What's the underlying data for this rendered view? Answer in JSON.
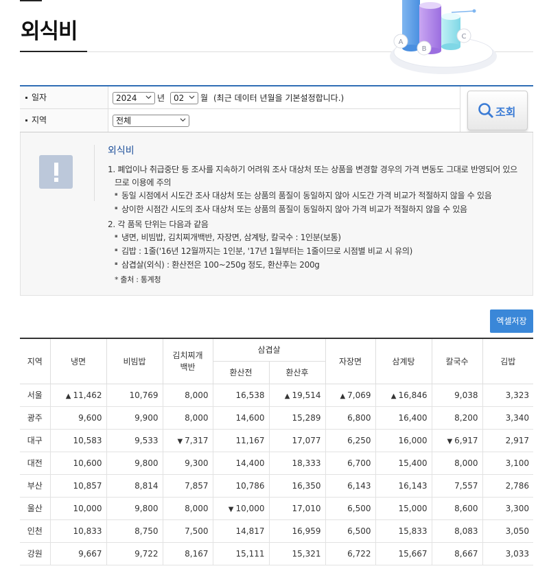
{
  "page": {
    "title": "외식비"
  },
  "hero": {
    "cylinder_labels": [
      "A",
      "B",
      "C"
    ]
  },
  "search": {
    "date_label": "일자",
    "year_value": "2024",
    "year_unit": "년",
    "month_value": "02",
    "month_unit": "월",
    "date_hint": "(최근 데이터 년월을 기본설정합니다.)",
    "region_label": "지역",
    "region_value": "전체",
    "query_button": "조회"
  },
  "notice": {
    "title": "외식비",
    "lines": [
      "1. 폐업이나 취급중단 등 조사를 지속하기 어려워 조사 대상처 또는 상품을 변경할 경우의 가격 변동도 그대로 반영되어 있으",
      "므로 이용에 주의",
      "동일 시점에서 시도간 조사 대상처 또는 상품의 품질이 동일하지 않아 시도간 가격 비교가 적절하지 않을 수 있음",
      "상이한 시점간 시도의 조사 대상처 또는 상품의 품질이 동일하지 않아 가격 비교가 적절하지 않을 수 있음",
      "2. 각 품목 단위는 다음과 같음",
      "냉면, 비빔밥, 김치찌개백반, 자장면, 삼계탕, 칼국수 : 1인분(보통)",
      "김밥 : 1줄('16년 12월까지는 1인분, '17년 1월부터는 1줄이므로 시점별 비교 시 유의)",
      "삼겹살(외식) : 환산전은 100~250g 정도, 환산후는 200g",
      "* 출처 : 통계청"
    ]
  },
  "excel_button": "엑셀저장",
  "table": {
    "headers": {
      "region": "지역",
      "naengmyeon": "냉면",
      "bibimbap": "비빔밥",
      "kimchi_line1": "김치찌개",
      "kimchi_line2": "백반",
      "samgyeopsal": "삼겹살",
      "before": "환산전",
      "after": "환산후",
      "jajangmyeon": "자장면",
      "samgyetang": "삼계탕",
      "kalguksu": "칼국수",
      "gimbap": "김밥"
    },
    "rows": [
      {
        "region": "서울",
        "cells": [
          {
            "v": "11,462",
            "t": "up"
          },
          {
            "v": "10,769",
            "t": ""
          },
          {
            "v": "8,000",
            "t": ""
          },
          {
            "v": "16,538",
            "t": ""
          },
          {
            "v": "19,514",
            "t": "up"
          },
          {
            "v": "7,069",
            "t": "up"
          },
          {
            "v": "16,846",
            "t": "up"
          },
          {
            "v": "9,038",
            "t": ""
          },
          {
            "v": "3,323",
            "t": ""
          }
        ]
      },
      {
        "region": "광주",
        "cells": [
          {
            "v": "9,600",
            "t": ""
          },
          {
            "v": "9,900",
            "t": ""
          },
          {
            "v": "8,000",
            "t": ""
          },
          {
            "v": "14,600",
            "t": ""
          },
          {
            "v": "15,289",
            "t": ""
          },
          {
            "v": "6,800",
            "t": ""
          },
          {
            "v": "16,400",
            "t": ""
          },
          {
            "v": "8,200",
            "t": ""
          },
          {
            "v": "3,340",
            "t": ""
          }
        ]
      },
      {
        "region": "대구",
        "cells": [
          {
            "v": "10,583",
            "t": ""
          },
          {
            "v": "9,533",
            "t": ""
          },
          {
            "v": "7,317",
            "t": "down"
          },
          {
            "v": "11,167",
            "t": ""
          },
          {
            "v": "17,077",
            "t": ""
          },
          {
            "v": "6,250",
            "t": ""
          },
          {
            "v": "16,000",
            "t": ""
          },
          {
            "v": "6,917",
            "t": "down"
          },
          {
            "v": "2,917",
            "t": ""
          }
        ]
      },
      {
        "region": "대전",
        "cells": [
          {
            "v": "10,600",
            "t": ""
          },
          {
            "v": "9,800",
            "t": ""
          },
          {
            "v": "9,300",
            "t": ""
          },
          {
            "v": "14,400",
            "t": ""
          },
          {
            "v": "18,333",
            "t": ""
          },
          {
            "v": "6,700",
            "t": ""
          },
          {
            "v": "15,400",
            "t": ""
          },
          {
            "v": "8,000",
            "t": ""
          },
          {
            "v": "3,100",
            "t": ""
          }
        ]
      },
      {
        "region": "부산",
        "cells": [
          {
            "v": "10,857",
            "t": ""
          },
          {
            "v": "8,814",
            "t": ""
          },
          {
            "v": "7,857",
            "t": ""
          },
          {
            "v": "10,786",
            "t": ""
          },
          {
            "v": "16,350",
            "t": ""
          },
          {
            "v": "6,143",
            "t": ""
          },
          {
            "v": "16,143",
            "t": ""
          },
          {
            "v": "7,557",
            "t": ""
          },
          {
            "v": "2,786",
            "t": ""
          }
        ]
      },
      {
        "region": "울산",
        "cells": [
          {
            "v": "10,000",
            "t": ""
          },
          {
            "v": "9,800",
            "t": ""
          },
          {
            "v": "8,000",
            "t": ""
          },
          {
            "v": "10,000",
            "t": "down"
          },
          {
            "v": "17,010",
            "t": ""
          },
          {
            "v": "6,500",
            "t": ""
          },
          {
            "v": "15,000",
            "t": ""
          },
          {
            "v": "8,600",
            "t": ""
          },
          {
            "v": "3,300",
            "t": ""
          }
        ]
      },
      {
        "region": "인천",
        "cells": [
          {
            "v": "10,833",
            "t": ""
          },
          {
            "v": "8,750",
            "t": ""
          },
          {
            "v": "7,500",
            "t": ""
          },
          {
            "v": "14,817",
            "t": ""
          },
          {
            "v": "16,959",
            "t": ""
          },
          {
            "v": "6,500",
            "t": ""
          },
          {
            "v": "15,833",
            "t": ""
          },
          {
            "v": "8,083",
            "t": ""
          },
          {
            "v": "3,050",
            "t": ""
          }
        ]
      },
      {
        "region": "강원",
        "cells": [
          {
            "v": "9,667",
            "t": ""
          },
          {
            "v": "9,722",
            "t": ""
          },
          {
            "v": "8,167",
            "t": ""
          },
          {
            "v": "15,111",
            "t": ""
          },
          {
            "v": "15,321",
            "t": ""
          },
          {
            "v": "6,722",
            "t": ""
          },
          {
            "v": "15,667",
            "t": ""
          },
          {
            "v": "8,667",
            "t": ""
          },
          {
            "v": "3,033",
            "t": ""
          }
        ]
      }
    ]
  },
  "colors": {
    "accent": "#2e6db5",
    "up": "#c0392b",
    "down": "#2960b8",
    "button": "#3a87d8"
  }
}
